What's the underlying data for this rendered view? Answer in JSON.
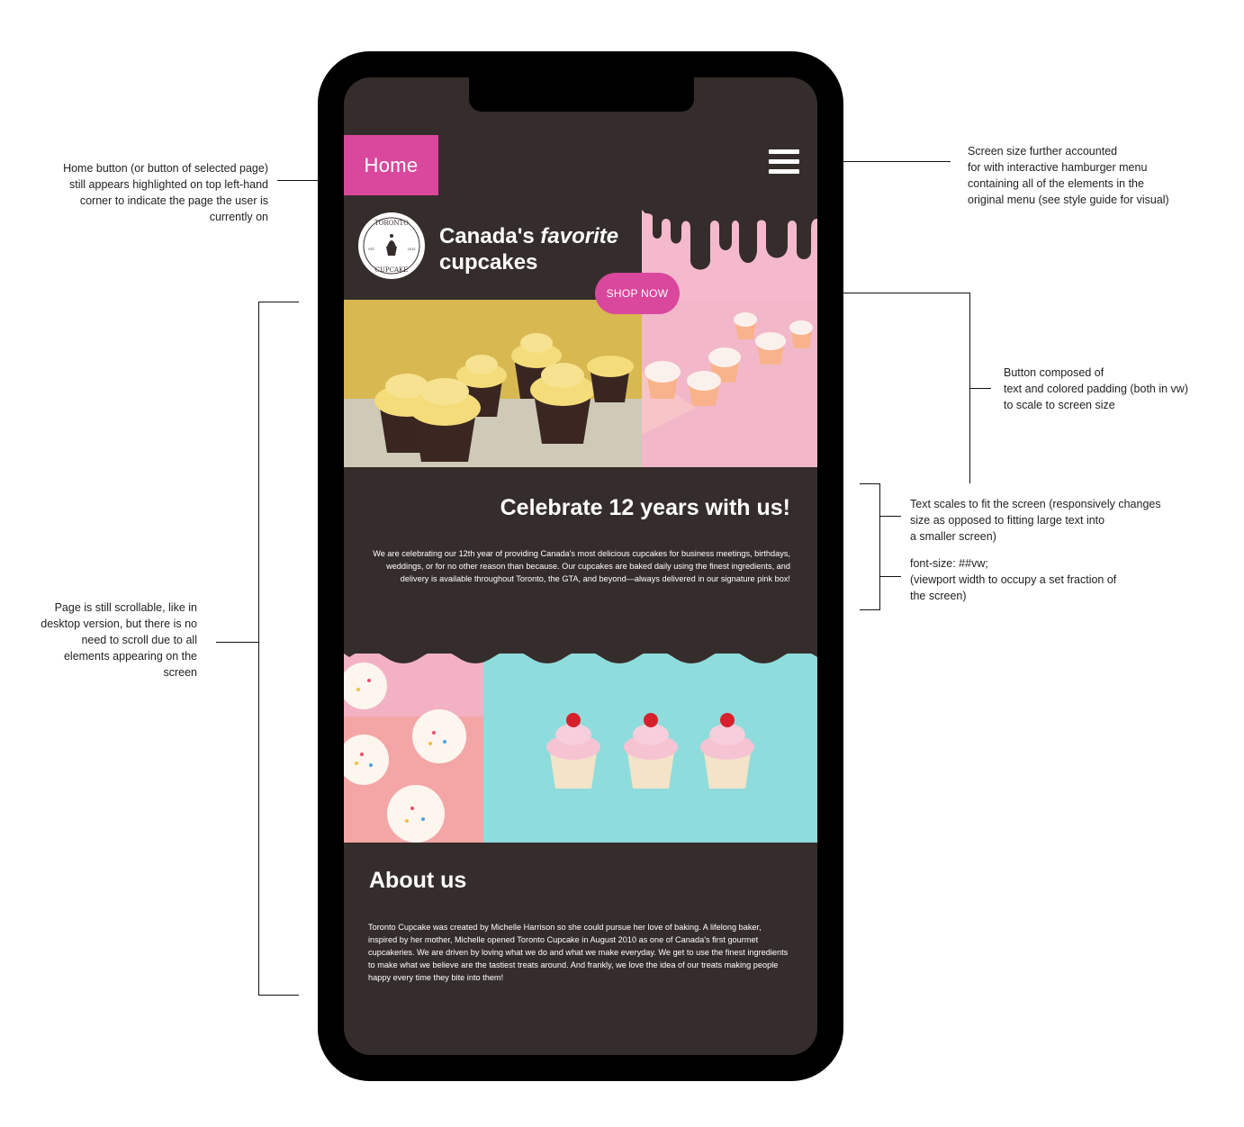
{
  "annotations": {
    "home_note": "Home button (or button of selected page) still appears highlighted on top left-hand corner to indicate the page the user is currently on",
    "home_note_lines": [
      "Home button (or button of selected page)",
      "still appears highlighted on top left-hand",
      "corner to indicate the page the user is",
      "currently on"
    ],
    "menu_note_lines": [
      "Screen size further accounted",
      "for with interactive hamburger menu",
      "containing all of the elements in the",
      "original menu (see style guide for visual)"
    ],
    "button_note_lines": [
      "Button composed of",
      "text and colored padding (both in vw)",
      "to scale to screen size"
    ],
    "text_note_lines": [
      "Text scales to fit the screen (responsively changes",
      "size as opposed to fitting large text into",
      "a smaller screen)"
    ],
    "font_note_lines": [
      "font-size: ##vw;",
      "(viewport width to occupy a set fraction of",
      "the screen)"
    ],
    "scroll_note_lines": [
      "Page is still scrollable, like in",
      "desktop version, but there is no",
      "need to scroll due to all",
      "elements appearing on the",
      "screen"
    ]
  },
  "nav": {
    "home_label": "Home"
  },
  "hero": {
    "title_line1_a": "Canada's ",
    "title_line1_b": "favorite",
    "title_line2": "cupcakes",
    "shop_label": "SHOP NOW",
    "logo_top": "TORONTO",
    "logo_bottom": "CUPCAKE",
    "logo_est": "EST.",
    "logo_year": "2010"
  },
  "celebrate": {
    "title": "Celebrate 12 years with us!",
    "body": "We are celebrating our 12th year of providing Canada's most delicious cupcakes for business meetings, birthdays, weddings, or for no other reason than because. Our cupcakes are baked daily using the finest ingredients, and delivery is available throughout Toronto, the GTA, and beyond—always delivered in our signature pink box!"
  },
  "about": {
    "title": "About us",
    "body": "Toronto Cupcake was created by Michelle Harrison so she could pursue her love of baking. A lifelong baker, inspired by her mother, Michelle opened Toronto Cupcake in August 2010 as one of Canada's first gourmet cupcakeries. We are driven by loving what we do and what we make everyday. We get to use the finest ingredients to make what we believe are the tastiest treats around. And frankly, we love the idea of our treats making people happy every time they bite into them!"
  },
  "colors": {
    "brand_pink": "#d9489c",
    "background_brown": "#352d2b",
    "light_pink": "#f4b9cd",
    "teal": "#8fdcdc"
  },
  "icons": [
    "hamburger-menu-icon",
    "cupcake-logo-icon"
  ]
}
